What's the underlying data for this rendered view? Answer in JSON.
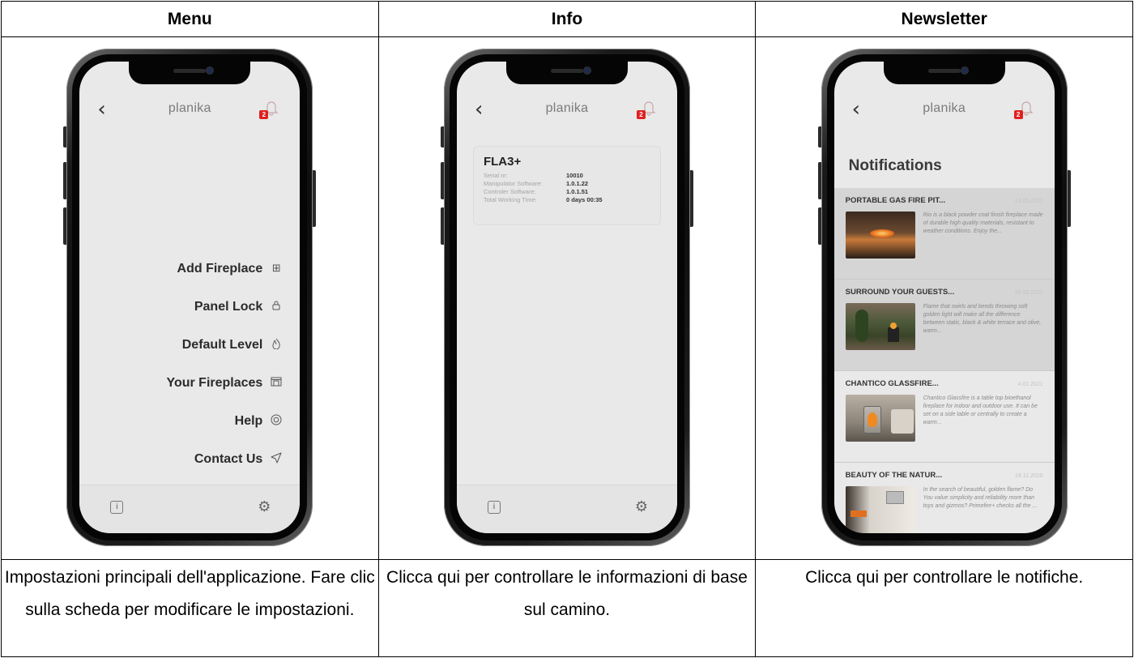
{
  "headers": [
    "Menu",
    "Info",
    "Newsletter"
  ],
  "captions": [
    "Impostazioni principali dell'applicazione. Fare clic sulla scheda per modificare le impostazioni.",
    "Clicca qui per controllare le informazioni di base sul camino.",
    "Clicca qui per controllare le notifiche."
  ],
  "app": {
    "brand": "planika",
    "back_icon": "chevron-left-icon",
    "bell_badge": "2"
  },
  "menu": {
    "items": [
      {
        "label": "Add Fireplace",
        "icon": "plus-square-icon"
      },
      {
        "label": "Panel Lock",
        "icon": "lock-icon"
      },
      {
        "label": "Default Level",
        "icon": "flame-icon"
      },
      {
        "label": "Your Fireplaces",
        "icon": "fireplace-icon"
      },
      {
        "label": "Help",
        "icon": "lifebuoy-icon"
      },
      {
        "label": "Contact Us",
        "icon": "send-icon"
      }
    ]
  },
  "info": {
    "device": "FLA3+",
    "rows": [
      {
        "key": "Serial nr:",
        "value": "10010"
      },
      {
        "key": "Manipulator Software:",
        "value": "1.0.1.22"
      },
      {
        "key": "Controler Software:",
        "value": "1.0.1.51"
      },
      {
        "key": "Total Working Time:",
        "value": "0 days  00:35"
      }
    ]
  },
  "notifications": {
    "title": "Notifications",
    "items": [
      {
        "title": "PORTABLE GAS FIRE PIT...",
        "date": "13.05.2021",
        "text": "Rio is a black powder coat finish fireplace made of durable high quality materials, resistant to weather conditions. Enjoy the..."
      },
      {
        "title": "SURROUND YOUR GUESTS...",
        "date": "20.03.2021",
        "text": "Flame that swirls and bends throwing soft golden light will make all the difference between static, black & white terrace and olive, warm..."
      },
      {
        "title": "CHANTICO GLASSFIRE...",
        "date": "4.01.2021",
        "text": "Chantico Glassfire is a table top bioethanol fireplace for indoor and outdoor use. It can be set on a side table or centrally to create a warm..."
      },
      {
        "title": "BEAUTY OF THE NATUR...",
        "date": "24.11.2020",
        "text": "In the search of beautiful, golden flame? Do You value simplicity and reliability more than toys and gizmos? Primefire+ checks all the ..."
      }
    ]
  },
  "colors": {
    "badge": "#e02020",
    "screen": "#e9e9e9",
    "text_dark": "#2b2b2b"
  }
}
